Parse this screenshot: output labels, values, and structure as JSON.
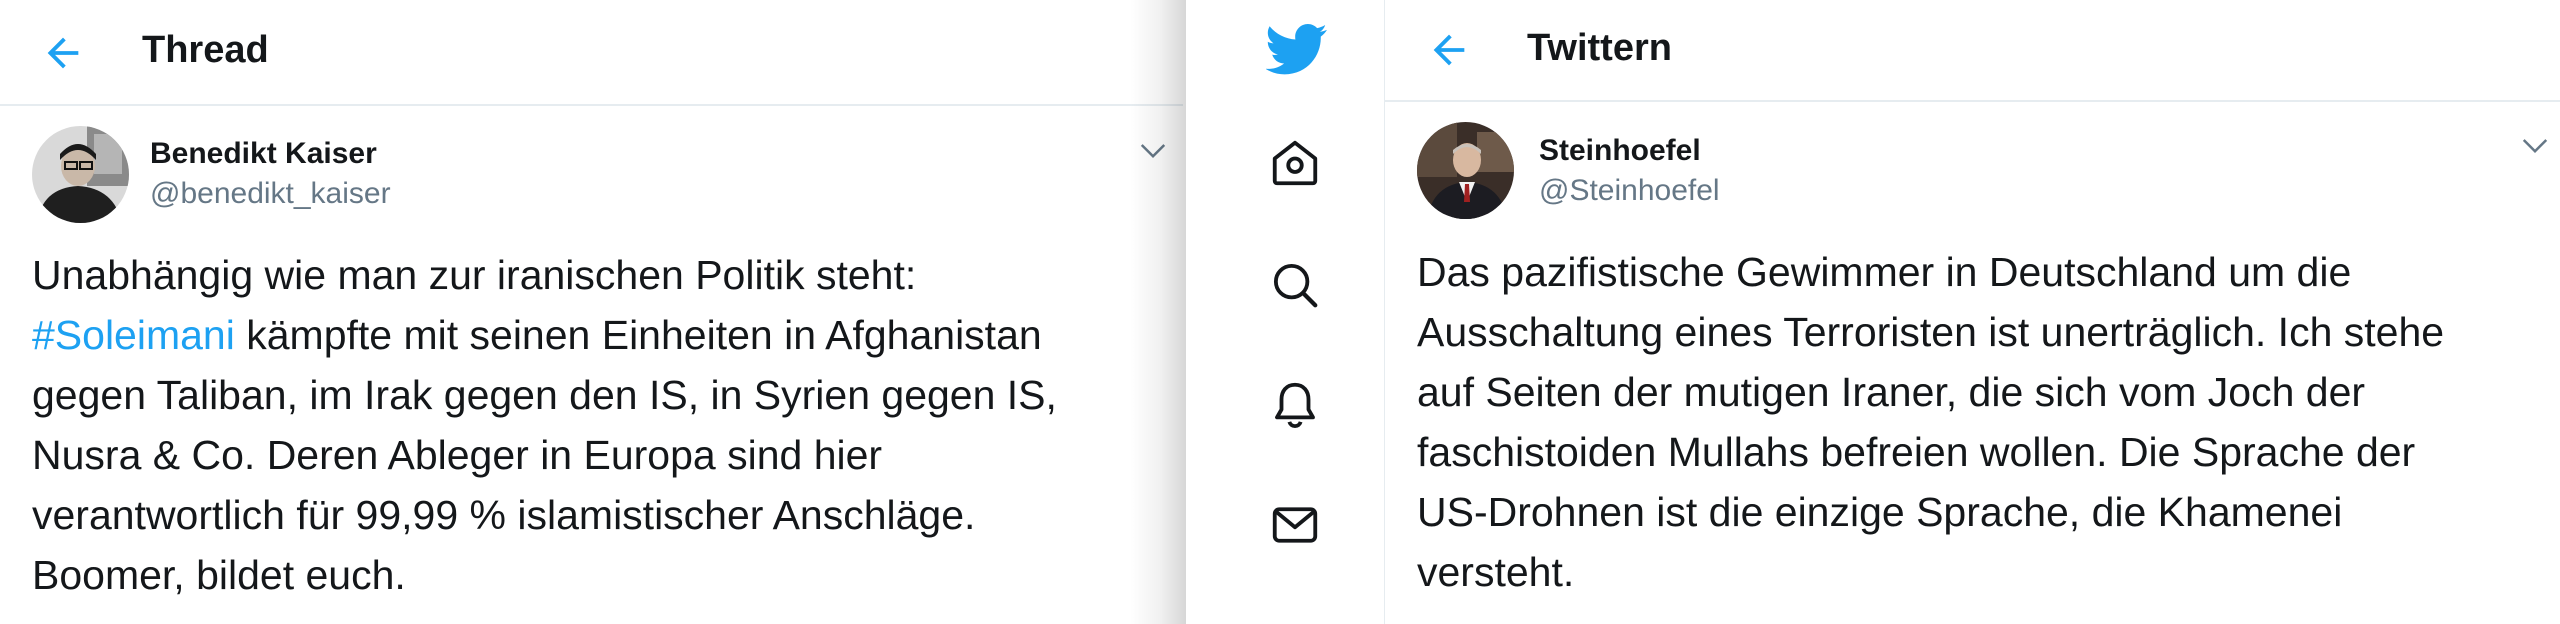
{
  "left": {
    "header": {
      "title": "Thread"
    },
    "tweet": {
      "name": "Benedikt Kaiser",
      "handle": "@benedikt_kaiser",
      "line1": "Unabhängig wie man zur iranischen Politik steht:",
      "hashtag": "#Soleimani",
      "line2_rest": " kämpfte mit seinen Einheiten in Afghanistan",
      "line3": "gegen Taliban, im Irak gegen den IS, in Syrien gegen IS,",
      "line4": "Nusra & Co. Deren Ableger in Europa sind hier",
      "line5": "verantwortlich für 99,99 % islamistischer Anschläge.",
      "line6": "Boomer, bildet euch."
    }
  },
  "nav": {
    "icons": [
      "twitter-logo-icon",
      "home-icon",
      "search-icon",
      "notifications-bell-icon",
      "messages-envelope-icon"
    ],
    "accent": "#1da1f2"
  },
  "right": {
    "header": {
      "title": "Twittern"
    },
    "tweet": {
      "name": "Steinhoefel",
      "handle": "@Steinhoefel",
      "lines": [
        "Das pazifistische Gewimmer in Deutschland um die",
        "Ausschaltung eines Terroristen ist unerträglich. Ich stehe",
        "auf Seiten der mutigen Iraner, die sich vom Joch der",
        "faschistoiden Mullahs befreien wollen. Die Sprache der",
        "US-Drohnen ist die einzige Sprache, die Khamenei",
        "versteht."
      ]
    }
  },
  "colors": {
    "accent": "#1da1f2",
    "text": "#14171a",
    "secondary": "#657786",
    "divider": "#e6ecf0"
  }
}
